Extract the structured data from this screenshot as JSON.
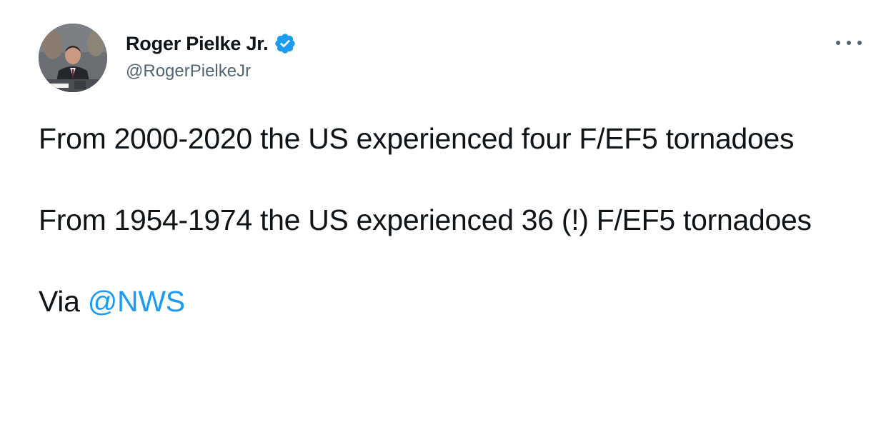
{
  "tweet": {
    "author": {
      "display_name": "Roger Pielke Jr.",
      "handle": "@RogerPielkeJr",
      "verified": true,
      "avatar_icon": "profile-photo"
    },
    "more_icon": "more-options-icon",
    "paragraphs": [
      "From 2000-2020 the US experienced four F/EF5 tornadoes",
      "From 1954-1974 the US experienced 36 (!) F/EF5 tornadoes"
    ],
    "via_text": "Via",
    "mention": "@NWS"
  },
  "colors": {
    "text": "#0f1419",
    "secondary": "#536471",
    "link": "#1d9bf0",
    "verified_badge": "#1d9bf0",
    "background": "#ffffff"
  }
}
